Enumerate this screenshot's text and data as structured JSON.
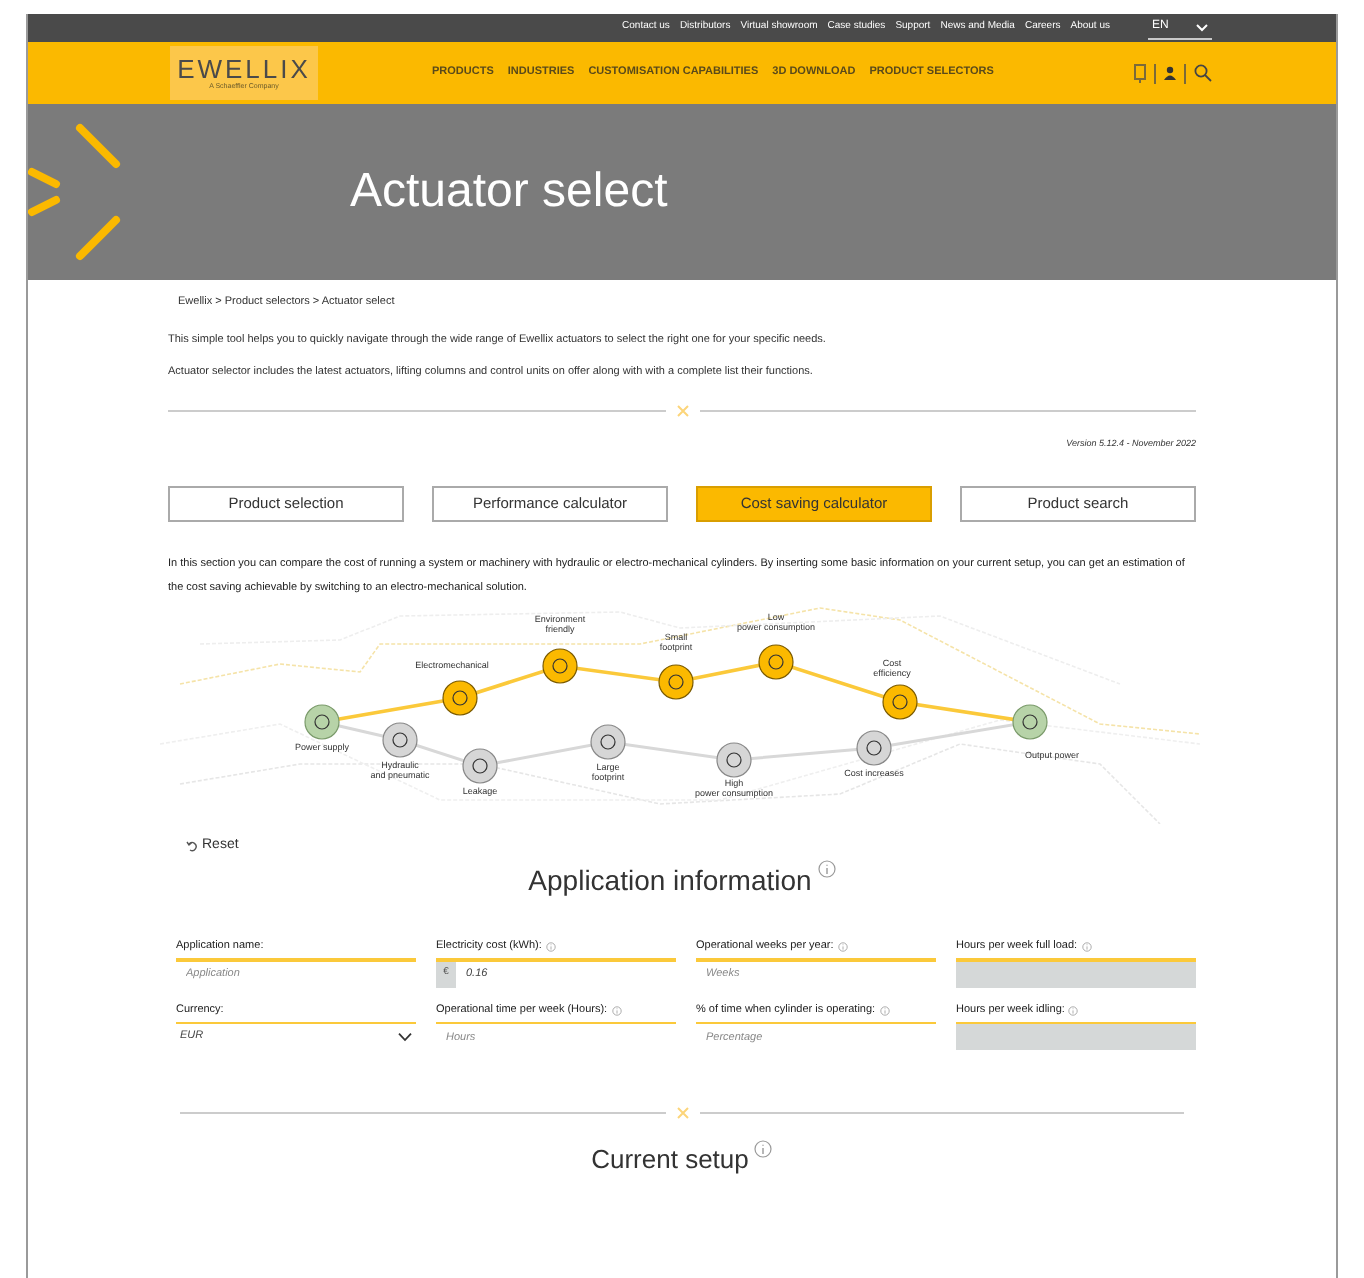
{
  "top_bar": {
    "links": [
      "Contact us",
      "Distributors",
      "Virtual showroom",
      "Case studies",
      "Support",
      "News and Media",
      "Careers",
      "About us"
    ],
    "language": "EN"
  },
  "header": {
    "logo": "EWELLIX",
    "logo_subtitle": "A Schaeffler Company",
    "nav": [
      "PRODUCTS",
      "INDUSTRIES",
      "CUSTOMISATION CAPABILITIES",
      "3D DOWNLOAD",
      "PRODUCT SELECTORS"
    ]
  },
  "hero": {
    "title": "Actuator select"
  },
  "breadcrumb": "Ewellix > Product selectors > Actuator select",
  "intro": [
    "This simple tool helps you to quickly navigate through the wide range of Ewellix actuators to select the right one for your specific needs.",
    "Actuator selector includes the latest actuators, lifting columns and control units on offer along with with a complete list their functions."
  ],
  "version": "Version 5.12.4 - November 2022",
  "tabs": [
    {
      "label": "Product selection",
      "selected": false
    },
    {
      "label": "Performance calculator",
      "selected": false
    },
    {
      "label": "Cost saving calculator",
      "selected": true
    },
    {
      "label": "Product search",
      "selected": false
    }
  ],
  "description": "In this section you can compare the cost of running a system or machinery with hydraulic or electro-mechanical cylinders. By inserting some basic information on your current setup, you can get an estimation of the cost saving achievable by switching to an electro-mechanical solution.",
  "diagram": {
    "nodes": [
      {
        "label": "Power supply",
        "kind": "endpoint"
      },
      {
        "label": "Electromechanical",
        "kind": "benefit"
      },
      {
        "label": "Hydraulic and pneumatic",
        "kind": "drawback"
      },
      {
        "label": "Environment friendly",
        "kind": "benefit"
      },
      {
        "label": "Leakage",
        "kind": "drawback"
      },
      {
        "label": "Large footprint",
        "kind": "drawback"
      },
      {
        "label": "Small footprint",
        "kind": "benefit"
      },
      {
        "label": "High power consumption",
        "kind": "drawback"
      },
      {
        "label": "Low power consumption",
        "kind": "benefit"
      },
      {
        "label": "Cost efficiency",
        "kind": "benefit"
      },
      {
        "label": "Cost increases",
        "kind": "drawback"
      },
      {
        "label": "Output power",
        "kind": "endpoint"
      }
    ]
  },
  "reset": "Reset",
  "application": {
    "title": "Application information",
    "fields": [
      {
        "label": "Application name:",
        "kind": "text",
        "info": false,
        "placeholder": "Application"
      },
      {
        "label": "Electricity cost (kWh):",
        "kind": "currency",
        "info": true,
        "prefix": "€",
        "value": "0.16"
      },
      {
        "label": "Operational weeks per year:",
        "kind": "text",
        "info": true,
        "placeholder": "Weeks"
      },
      {
        "label": "Hours per week full load:",
        "kind": "readonly",
        "info": true
      },
      {
        "label": "Currency:",
        "kind": "select",
        "info": false,
        "value": "EUR"
      },
      {
        "label": "Operational time per week (Hours):",
        "kind": "text",
        "info": true,
        "placeholder": "Hours"
      },
      {
        "label": "% of time when cylinder is operating:",
        "kind": "text",
        "info": true,
        "placeholder": "Percentage"
      },
      {
        "label": "Hours per week idling:",
        "kind": "readonly",
        "info": true
      }
    ]
  },
  "current_setup": {
    "title": "Current setup"
  }
}
